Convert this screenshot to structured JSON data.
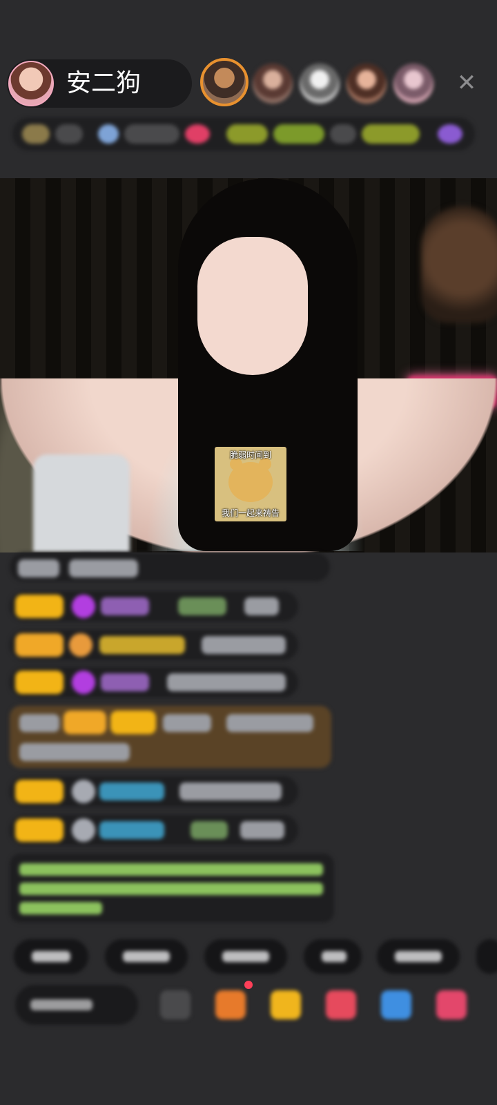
{
  "header": {
    "host_name": "安二狗",
    "close_label": "✕"
  },
  "video": {
    "sticker": {
      "top_text": "脆弱时间到",
      "bottom_text": "我们一起来祷告"
    }
  },
  "colors": {
    "background": "#2b2b2d",
    "badge_gold": "#f2b416",
    "system_text_green": "#8cc25e",
    "notification_dot": "#ff3f58"
  },
  "icons": [
    "avatar",
    "close-icon",
    "gem-icon",
    "gift-icon",
    "game-icon",
    "shop-icon",
    "more-icon"
  ]
}
